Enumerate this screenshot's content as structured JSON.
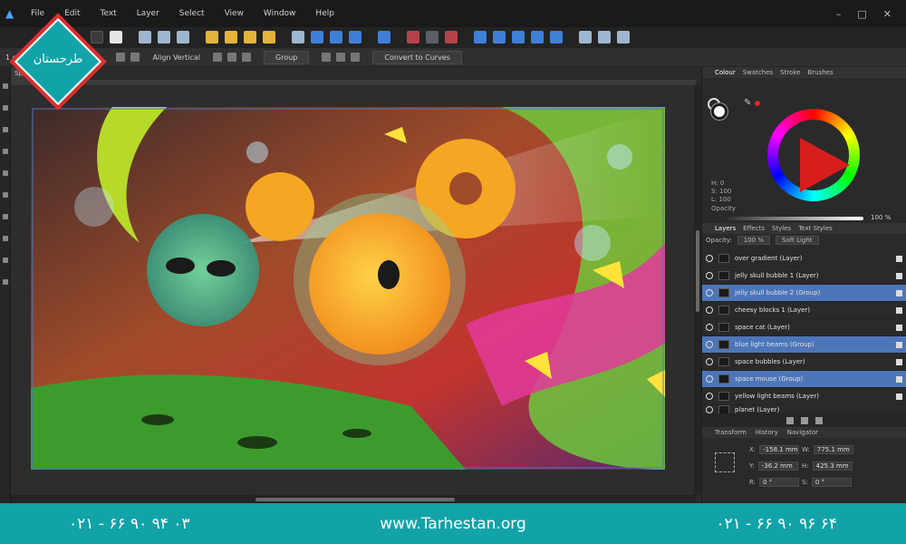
{
  "menu": {
    "items": [
      "File",
      "Edit",
      "Text",
      "Layer",
      "Select",
      "View",
      "Window",
      "Help"
    ],
    "window_controls": [
      "–",
      "□",
      "✕"
    ]
  },
  "context_bar": {
    "selection_label": "1 objects",
    "align_label": "Align Vertical",
    "group_label": "Group",
    "convert_label": "Convert to Curves"
  },
  "document": {
    "tab_label": "Space"
  },
  "color_panel": {
    "tabs": [
      "Colour",
      "Swatches",
      "Stroke",
      "Brushes"
    ],
    "hsl": [
      "H: 0",
      "S: 100",
      "L: 100"
    ],
    "opacity_label": "Opacity",
    "opacity_value": "100 %"
  },
  "layers_panel": {
    "tabs": [
      "Layers",
      "Effects",
      "Styles",
      "Text Styles"
    ],
    "opacity_label": "Opacity:",
    "opacity_value": "100 %",
    "blend_mode": "Soft Light",
    "layers": [
      {
        "name": "over gradient (Layer)",
        "selected": false
      },
      {
        "name": "jelly skull bubble 1 (Layer)",
        "selected": false
      },
      {
        "name": "jelly skull bubble 2 (Group)",
        "selected": true
      },
      {
        "name": "cheesy blocks 1 (Layer)",
        "selected": false
      },
      {
        "name": "space cat (Layer)",
        "selected": false
      },
      {
        "name": "blue light beams (Group)",
        "selected": true
      },
      {
        "name": "space bubbles (Layer)",
        "selected": false
      },
      {
        "name": "space mouse (Group)",
        "selected": true
      },
      {
        "name": "yellow light beams (Layer)",
        "selected": false
      },
      {
        "name": "planet (Layer)",
        "selected": false
      }
    ]
  },
  "transform_panel": {
    "tabs": [
      "Transform",
      "History",
      "Navigator"
    ],
    "x_label": "X:",
    "x_value": "-158.1 mm",
    "y_label": "Y:",
    "y_value": "-36.2 mm",
    "w_label": "W:",
    "w_value": "775.1 mm",
    "h_label": "H:",
    "h_value": "425.3 mm",
    "r_label": "R:",
    "r_value": "0 °",
    "s_label": "S:",
    "s_value": "0 °"
  },
  "footer": {
    "phone_left": "۰۲۱ - ۶۶ ۹۰ ۹۴ ۰۳",
    "website": "www.Tarhestan.org",
    "phone_right": "۰۲۱ - ۶۶ ۹۰ ۹۶ ۶۴"
  },
  "logo": {
    "text": "طرحستان"
  },
  "colors": {
    "accent": "#4d76b9",
    "brand": "#12a3a8",
    "logo_ring": "#e02d2d"
  }
}
